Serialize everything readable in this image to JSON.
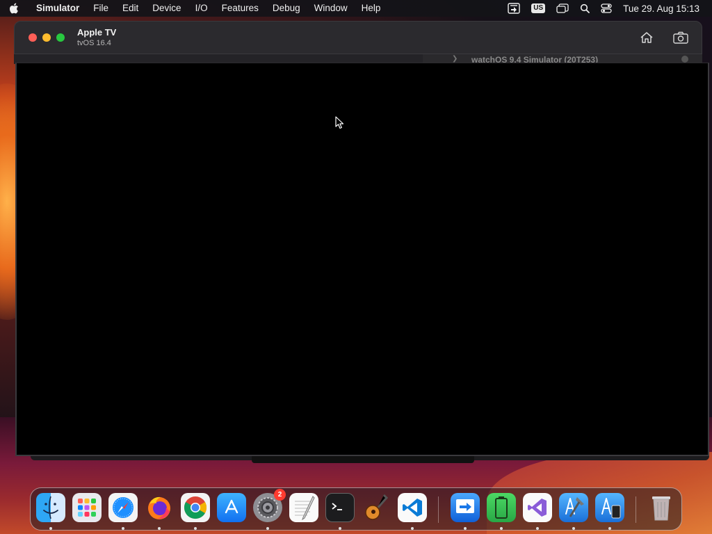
{
  "menubar": {
    "apple_icon": "apple-logo-icon",
    "app_name": "Simulator",
    "items": [
      "File",
      "Edit",
      "Device",
      "I/O",
      "Features",
      "Debug",
      "Window",
      "Help"
    ],
    "status": {
      "keyboard_layout": "US",
      "clock": "Tue 29. Aug  15:13"
    }
  },
  "window": {
    "title": "Apple TV",
    "subtitle": "tvOS 16.4",
    "buttons": [
      "home-icon",
      "screenshot-icon"
    ]
  },
  "background_window": {
    "row_text": "watchOS 9.4 Simulator (20T253)"
  },
  "dock": {
    "apps": [
      {
        "name": "Finder"
      },
      {
        "name": "Launchpad"
      },
      {
        "name": "Safari"
      },
      {
        "name": "Firefox"
      },
      {
        "name": "Google Chrome"
      },
      {
        "name": "App Store"
      },
      {
        "name": "System Settings",
        "badge": "2"
      },
      {
        "name": "TextEdit"
      },
      {
        "name": "Terminal"
      },
      {
        "name": "GarageBand"
      },
      {
        "name": "Visual Studio Code"
      },
      {
        "name": "Migration Assistant"
      },
      {
        "name": "Battery Utility"
      },
      {
        "name": "Visual Studio"
      },
      {
        "name": "Xcode"
      },
      {
        "name": "Simulator"
      },
      {
        "name": "Trash"
      }
    ]
  },
  "colors": {
    "accent": "#0a84ff",
    "close": "#ff5f57",
    "minimize": "#febc2e",
    "maximize": "#28c840"
  }
}
